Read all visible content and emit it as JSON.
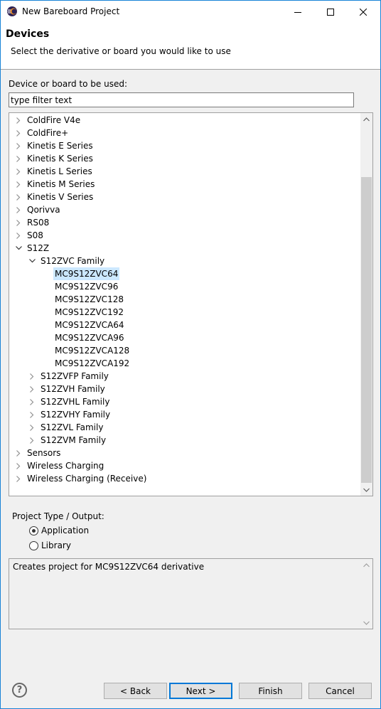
{
  "window": {
    "title": "New Bareboard Project",
    "controls": [
      "minimize",
      "maximize",
      "close"
    ]
  },
  "header": {
    "title": "Devices",
    "description": "Select the derivative or board you would like to use"
  },
  "device_section": {
    "label": "Device or board to be used:",
    "filter_value": "type filter text"
  },
  "tree": {
    "items": [
      {
        "label": "ColdFire V4e",
        "level": 0,
        "state": "collapsed"
      },
      {
        "label": "ColdFire+",
        "level": 0,
        "state": "collapsed"
      },
      {
        "label": "Kinetis E Series",
        "level": 0,
        "state": "collapsed"
      },
      {
        "label": "Kinetis K Series",
        "level": 0,
        "state": "collapsed"
      },
      {
        "label": "Kinetis L Series",
        "level": 0,
        "state": "collapsed"
      },
      {
        "label": "Kinetis M Series",
        "level": 0,
        "state": "collapsed"
      },
      {
        "label": "Kinetis V Series",
        "level": 0,
        "state": "collapsed"
      },
      {
        "label": "Qorivva",
        "level": 0,
        "state": "collapsed"
      },
      {
        "label": "RS08",
        "level": 0,
        "state": "collapsed"
      },
      {
        "label": "S08",
        "level": 0,
        "state": "collapsed"
      },
      {
        "label": "S12Z",
        "level": 0,
        "state": "expanded"
      },
      {
        "label": "S12ZVC Family",
        "level": 1,
        "state": "expanded"
      },
      {
        "label": "MC9S12ZVC64",
        "level": 2,
        "state": "leaf",
        "selected": true
      },
      {
        "label": "MC9S12ZVC96",
        "level": 2,
        "state": "leaf"
      },
      {
        "label": "MC9S12ZVC128",
        "level": 2,
        "state": "leaf"
      },
      {
        "label": "MC9S12ZVC192",
        "level": 2,
        "state": "leaf"
      },
      {
        "label": "MC9S12ZVCA64",
        "level": 2,
        "state": "leaf"
      },
      {
        "label": "MC9S12ZVCA96",
        "level": 2,
        "state": "leaf"
      },
      {
        "label": "MC9S12ZVCA128",
        "level": 2,
        "state": "leaf"
      },
      {
        "label": "MC9S12ZVCA192",
        "level": 2,
        "state": "leaf"
      },
      {
        "label": "S12ZVFP Family",
        "level": 1,
        "state": "collapsed"
      },
      {
        "label": "S12ZVH Family",
        "level": 1,
        "state": "collapsed"
      },
      {
        "label": "S12ZVHL Family",
        "level": 1,
        "state": "collapsed"
      },
      {
        "label": "S12ZVHY Family",
        "level": 1,
        "state": "collapsed"
      },
      {
        "label": "S12ZVL Family",
        "level": 1,
        "state": "collapsed"
      },
      {
        "label": "S12ZVM Family",
        "level": 1,
        "state": "collapsed"
      },
      {
        "label": "Sensors",
        "level": 0,
        "state": "collapsed"
      },
      {
        "label": "Wireless Charging",
        "level": 0,
        "state": "collapsed"
      },
      {
        "label": "Wireless Charging (Receive)",
        "level": 0,
        "state": "collapsed"
      }
    ]
  },
  "project_type": {
    "label": "Project Type / Output:",
    "options": [
      {
        "label": "Application",
        "checked": true
      },
      {
        "label": "Library",
        "checked": false
      }
    ]
  },
  "description": {
    "text": "Creates project for MC9S12ZVC64 derivative"
  },
  "buttons": {
    "back": "< Back",
    "next": "Next >",
    "finish": "Finish",
    "cancel": "Cancel",
    "help": "?"
  },
  "colors": {
    "selection": "#cce8ff",
    "window_border": "#1883d7",
    "default_button_border": "#0078d7"
  }
}
